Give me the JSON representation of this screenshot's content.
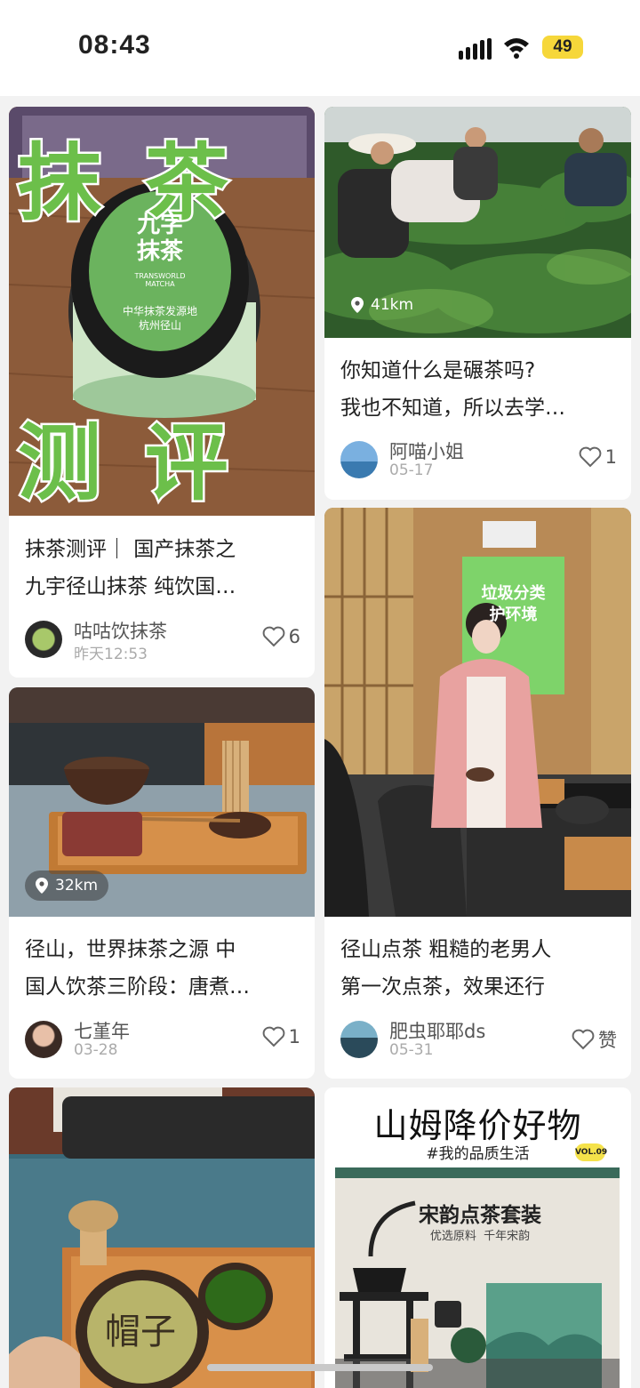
{
  "status_bar": {
    "time": "08:43",
    "battery": "49"
  },
  "cards": [
    {
      "title_lines": [
        "抹茶测评｜ 国产抹茶之",
        "九宇径山抹茶 纯饮国…"
      ],
      "author": "咕咕饮抹茶",
      "date": "昨天12:53",
      "likes": "6",
      "image_text": {
        "top": "抹 茶",
        "bottom": "测 评",
        "lid_brand": "九字\n抹茶",
        "lid_en": "TRANSWORLD MATCHA",
        "lid_sub": "中华抹茶发源地\n杭州径山"
      }
    },
    {
      "title_lines": [
        "你知道什么是碾茶吗?",
        "我也不知道，所以去学…"
      ],
      "author": "阿喵小姐",
      "date": "05-17",
      "likes": "1",
      "distance": "41km"
    },
    {
      "title_lines": [
        "径山，世界抹茶之源 中",
        "国人饮茶三阶段：唐煮…"
      ],
      "author": "七堇年",
      "date": "03-28",
      "likes": "1",
      "distance": "32km"
    },
    {
      "title_lines": [
        "径山点茶 粗糙的老男人",
        "第一次点茶，效果还行"
      ],
      "author": "肥虫耶耶ds",
      "date": "05-31",
      "likes": "赞",
      "image_text": {
        "poster_line1": "垃圾分类",
        "poster_line2": "护环境"
      }
    },
    {
      "image_text": {
        "bowl": "帽子"
      }
    },
    {
      "image_text": {
        "headline": "山姆降价好物",
        "tag": "#我的品质生活",
        "vol": "VOL.09",
        "sub_title": "宋韵点茶套装",
        "sub_caption": "优选原料  千年宋韵"
      }
    }
  ]
}
